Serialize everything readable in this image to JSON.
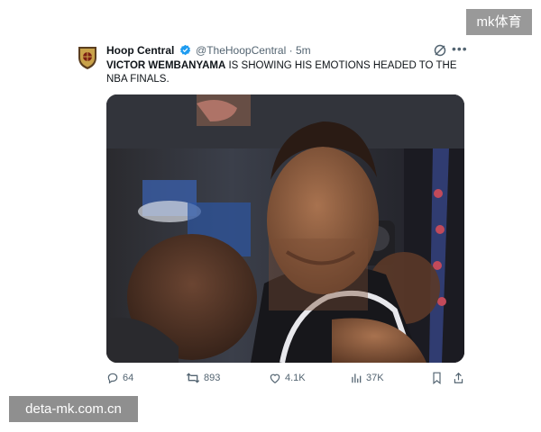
{
  "watermarks": {
    "top_right": "mk体育",
    "bottom_left": "deta-mk.com.cn"
  },
  "tweet": {
    "author_name": "Hoop Central",
    "handle": "@TheHoopCentral",
    "separator": "·",
    "time": "5m",
    "text_bold": "VICTOR WEMBANYAMA",
    "text_rest": " IS SHOWING HIS EMOTIONS HEADED TO THE NBA FINALS.",
    "actions": {
      "replies": "64",
      "reposts": "893",
      "likes": "4.1K",
      "views": "37K"
    },
    "colors": {
      "verified": "#1d9bf0",
      "secondary_text": "#536471"
    },
    "icons": [
      "verified-badge-icon",
      "grok-icon",
      "more-icon",
      "reply-icon",
      "repost-icon",
      "like-icon",
      "views-icon",
      "bookmark-icon",
      "share-icon"
    ]
  }
}
